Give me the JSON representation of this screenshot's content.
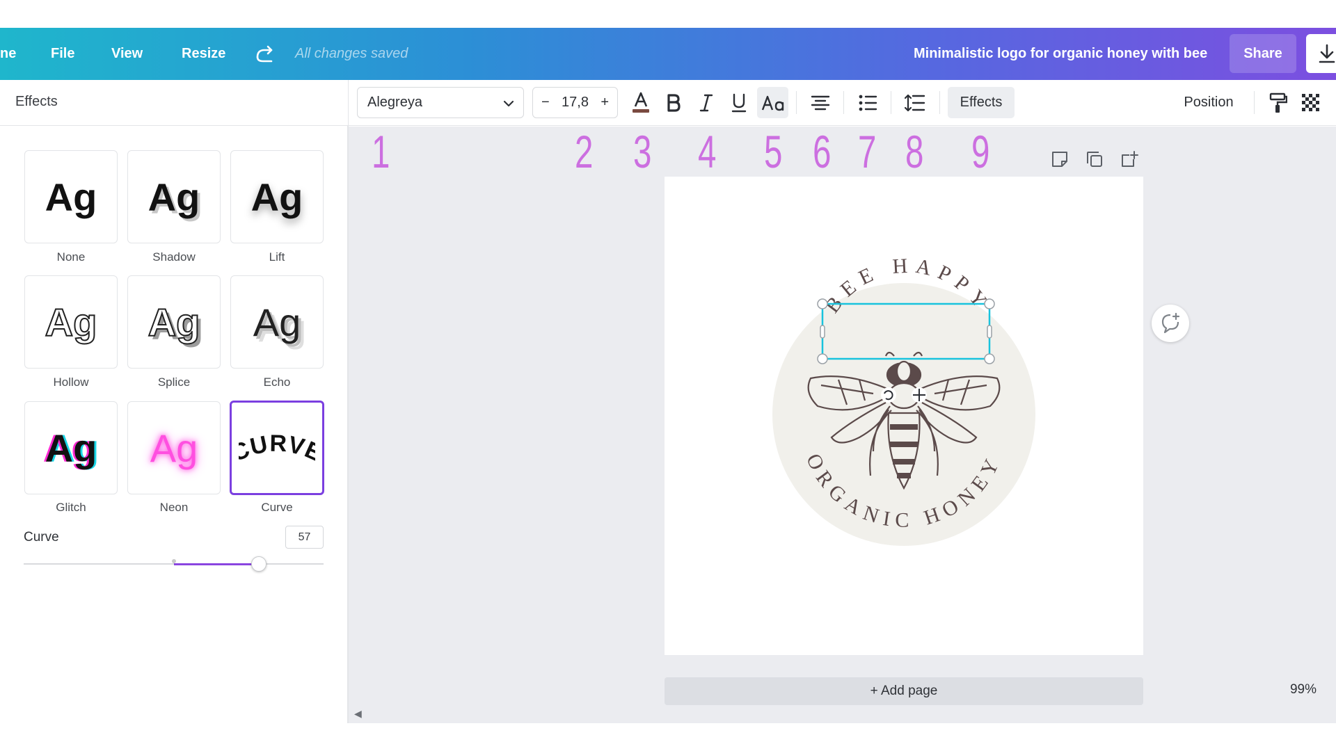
{
  "header": {
    "nav": [
      {
        "label": "ne"
      },
      {
        "label": "File"
      },
      {
        "label": "View"
      },
      {
        "label": "Resize"
      }
    ],
    "saved_status": "All changes saved",
    "doc_title": "Minimalistic logo for organic honey with bee",
    "share_label": "Share"
  },
  "panel": {
    "title": "Effects",
    "effects": [
      {
        "label": "None",
        "preview": "Ag"
      },
      {
        "label": "Shadow",
        "preview": "Ag"
      },
      {
        "label": "Lift",
        "preview": "Ag"
      },
      {
        "label": "Hollow",
        "preview": "Ag"
      },
      {
        "label": "Splice",
        "preview": "Ag"
      },
      {
        "label": "Echo",
        "preview": "Ag"
      },
      {
        "label": "Glitch",
        "preview": "Ag"
      },
      {
        "label": "Neon",
        "preview": "Ag"
      },
      {
        "label": "Curve",
        "preview": "CURVE"
      }
    ],
    "selected": "Curve",
    "curve": {
      "label": "Curve",
      "value": "57",
      "value_fraction": 0.785
    }
  },
  "toolbar": {
    "font": "Alegreya",
    "font_size": "17,8",
    "minus": "−",
    "plus": "+",
    "effects_label": "Effects",
    "position_label": "Position",
    "text_color": "#7a4a40"
  },
  "annotations": [
    "1",
    "2",
    "3",
    "4",
    "5",
    "6",
    "7",
    "8",
    "9"
  ],
  "canvas": {
    "add_page": "+ Add page",
    "zoom": "99%",
    "logo_top_text": "BEE HAPPY",
    "logo_bottom_text": "ORGANIC HONEY"
  },
  "colors": {
    "accent": "#7b3fe0",
    "annotation": "#cc6fe0",
    "logo_ink": "#5b4a4a",
    "logo_bg": "#f1f0eb",
    "selection": "#19c3dd"
  }
}
